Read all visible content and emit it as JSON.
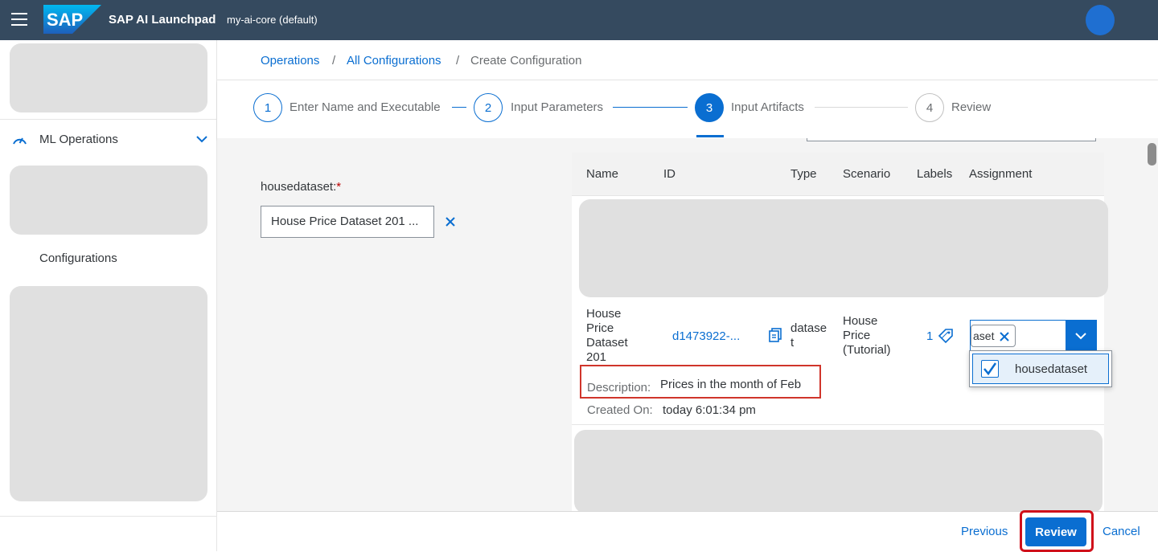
{
  "shell": {
    "brand": "SAP",
    "title": "SAP AI Launchpad",
    "subtitle": "my-ai-core (default)"
  },
  "sidebar": {
    "ml_operations": "ML Operations",
    "configurations": "Configurations"
  },
  "breadcrumb": {
    "operations": "Operations",
    "sep": "/",
    "all_configurations": "All Configurations",
    "current": "Create Configuration"
  },
  "wizard": {
    "steps": [
      {
        "number": "1",
        "label": "Enter Name and Executable"
      },
      {
        "number": "2",
        "label": "Input Parameters"
      },
      {
        "number": "3",
        "label": "Input Artifacts"
      },
      {
        "number": "4",
        "label": "Review"
      }
    ],
    "active_step": "3"
  },
  "form": {
    "label": "housedataset:",
    "required_mark": "*",
    "value": "House Price Dataset 201 ..."
  },
  "table": {
    "headers": [
      "Name",
      "ID",
      "Type",
      "Scenario",
      "Labels",
      "Assignment"
    ],
    "row": {
      "name_lines": [
        "House",
        "Price",
        "Dataset",
        "201"
      ],
      "id": "d1473922-...",
      "type_lines": [
        "datase",
        "t"
      ],
      "scenario_lines": [
        "House",
        "Price",
        "(Tutorial)"
      ],
      "labels": "1",
      "assignment_token": "aset",
      "description_label": "Description:",
      "description": "Prices in the month of Feb",
      "created_label": "Created On:",
      "created": "today 6:01:34 pm"
    },
    "dropdown_option": "housedataset"
  },
  "footer": {
    "previous": "Previous",
    "review": "Review",
    "cancel": "Cancel"
  },
  "colors": {
    "shell": "#354a5f",
    "accent": "#0a6ed1",
    "highlight": "#d0352b"
  }
}
